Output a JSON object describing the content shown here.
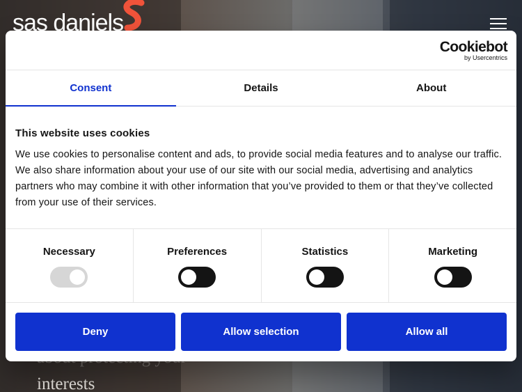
{
  "background": {
    "logo_text": "sas daniels",
    "hero_line1": "about protecting your",
    "hero_line2": "interests",
    "brand_color": "#f0533a"
  },
  "cookiebot": {
    "brand": "Cookiebot",
    "byline": "by Usercentrics",
    "tabs": [
      {
        "label": "Consent",
        "active": true
      },
      {
        "label": "Details",
        "active": false
      },
      {
        "label": "About",
        "active": false
      }
    ],
    "heading": "This website uses cookies",
    "description": "We use cookies to personalise content and ads, to provide social media features and to analyse our traffic. We also share information about your use of our site with our social media, advertising and analytics partners who may combine it with other information that you’ve provided to them or that they’ve collected from your use of their services.",
    "categories": [
      {
        "label": "Necessary",
        "enabled": true,
        "disabled": true
      },
      {
        "label": "Preferences",
        "enabled": false,
        "disabled": false
      },
      {
        "label": "Statistics",
        "enabled": false,
        "disabled": false
      },
      {
        "label": "Marketing",
        "enabled": false,
        "disabled": false
      }
    ],
    "buttons": {
      "deny": "Deny",
      "allow_selection": "Allow selection",
      "allow_all": "Allow all"
    },
    "accent_color": "#1032cf"
  }
}
